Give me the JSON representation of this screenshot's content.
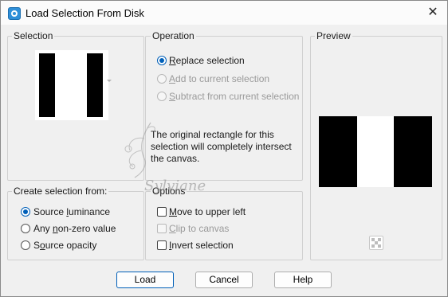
{
  "window": {
    "title": "Load Selection From Disk",
    "close_glyph": "✕"
  },
  "selection": {
    "title": "Selection"
  },
  "operation": {
    "title": "Operation",
    "options": [
      {
        "prefix": "",
        "underline": "R",
        "rest": "eplace selection",
        "checked": true,
        "enabled": true
      },
      {
        "prefix": "",
        "underline": "A",
        "rest": "dd to current selection",
        "checked": false,
        "enabled": false
      },
      {
        "prefix": "",
        "underline": "S",
        "rest": "ubtract from current selection",
        "checked": false,
        "enabled": false
      }
    ],
    "info": "The original rectangle for this selection will completely intersect the canvas."
  },
  "preview": {
    "title": "Preview"
  },
  "create_from": {
    "title": "Create selection from:",
    "options": [
      {
        "prefix": "Source ",
        "underline": "l",
        "rest": "uminance",
        "checked": true
      },
      {
        "prefix": "Any ",
        "underline": "n",
        "rest": "on-zero value",
        "checked": false
      },
      {
        "prefix": "S",
        "underline": "o",
        "rest": "urce opacity",
        "checked": false
      }
    ]
  },
  "options": {
    "title": "Options",
    "items": [
      {
        "prefix": "",
        "underline": "M",
        "rest": "ove to upper left",
        "checked": false,
        "enabled": true
      },
      {
        "prefix": "",
        "underline": "C",
        "rest": "lip to canvas",
        "checked": false,
        "enabled": false
      },
      {
        "prefix": "",
        "underline": "I",
        "rest": "nvert selection",
        "checked": false,
        "enabled": true
      }
    ]
  },
  "buttons": {
    "load": "Load",
    "cancel": "Cancel",
    "help": "Help"
  },
  "watermark": {
    "text": "Sylviane"
  },
  "colors": {
    "accent": "#005fb8",
    "black": "#000000",
    "white": "#ffffff"
  }
}
